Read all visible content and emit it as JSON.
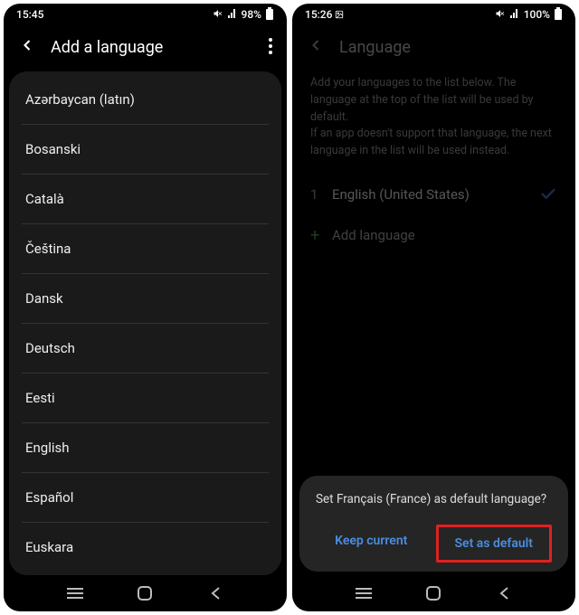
{
  "left": {
    "status": {
      "time": "15:45",
      "battery": "98%"
    },
    "header": {
      "title": "Add a language"
    },
    "languages": [
      "Azərbaycan (latın)",
      "Bosanski",
      "Català",
      "Čeština",
      "Dansk",
      "Deutsch",
      "Eesti",
      "English",
      "Español",
      "Euskara"
    ]
  },
  "right": {
    "status": {
      "time": "15:26",
      "battery": "100%"
    },
    "header": {
      "title": "Language"
    },
    "info_line1": "Add your languages to the list below. The language at the top of the list will be used by default.",
    "info_line2": "If an app doesn't support that language, the next language in the list will be used instead.",
    "current": {
      "index": "1",
      "name": "English (United States)"
    },
    "add_label": "Add language",
    "dialog": {
      "title": "Set Français (France) as default language?",
      "keep": "Keep current",
      "set": "Set as default"
    }
  }
}
